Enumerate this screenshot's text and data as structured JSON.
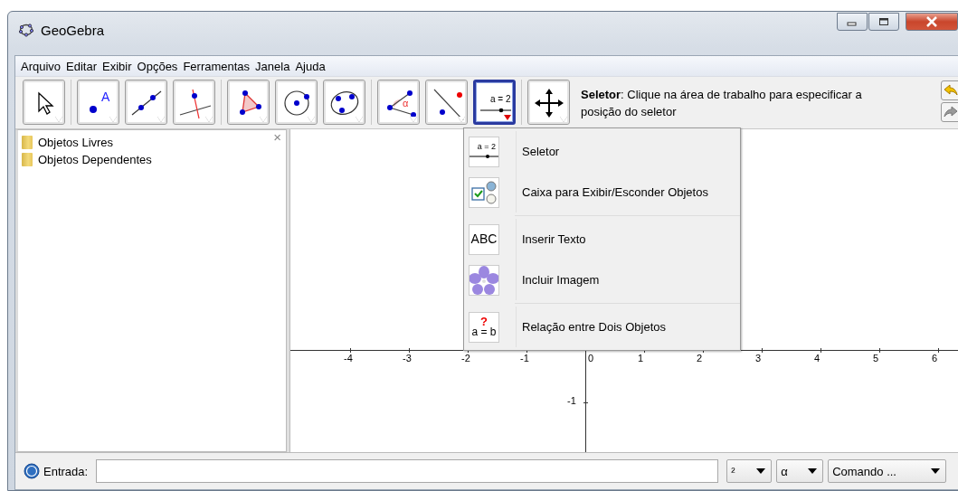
{
  "window": {
    "title": "GeoGebra"
  },
  "menu": [
    "Arquivo",
    "Editar",
    "Exibir",
    "Opções",
    "Ferramentas",
    "Janela",
    "Ajuda"
  ],
  "toolbar": {
    "groups": [
      [
        {
          "kind": "move",
          "selected": false
        }
      ],
      [
        {
          "kind": "point",
          "label": "A",
          "selected": false
        },
        {
          "kind": "line",
          "selected": false
        },
        {
          "kind": "perpendicular",
          "selected": false
        }
      ],
      [
        {
          "kind": "polygon",
          "selected": false
        },
        {
          "kind": "circle",
          "selected": false
        },
        {
          "kind": "conic",
          "selected": false
        }
      ],
      [
        {
          "kind": "angle",
          "label": "α",
          "selected": false
        },
        {
          "kind": "reflect",
          "selected": false
        },
        {
          "kind": "slider",
          "label": "a = 2",
          "selected": true
        }
      ],
      [
        {
          "kind": "pan",
          "selected": false
        }
      ]
    ],
    "help": "**Seletor**: Clique na área de trabalho para especificar a posição do seletor"
  },
  "algebra": {
    "close": "×",
    "folders": [
      "Objetos Livres",
      "Objetos Dependentes"
    ]
  },
  "graphics": {
    "x_ticks": [
      "-4",
      "-3",
      "-2",
      "-1",
      "0",
      "1",
      "2",
      "3",
      "4",
      "5",
      "6"
    ],
    "y_ticks": [
      "-1"
    ]
  },
  "tool_menu": {
    "groups": [
      [
        {
          "kind": "slider",
          "icon_text": "a = 2",
          "label": "Seletor"
        },
        {
          "kind": "checkbox",
          "label": "Caixa para Exibir/Esconder Objetos"
        }
      ],
      [
        {
          "kind": "text",
          "icon_text": "ABC",
          "label": "Inserir Texto"
        },
        {
          "kind": "image",
          "label": "Incluir Imagem"
        }
      ],
      [
        {
          "kind": "relation",
          "icon_text": "a = b",
          "icon_mark": "?",
          "label": "Relação entre Dois Objetos"
        }
      ]
    ]
  },
  "input_bar": {
    "label": "Entrada:",
    "dropdowns": [
      "²",
      "α",
      "Comando ..."
    ]
  }
}
